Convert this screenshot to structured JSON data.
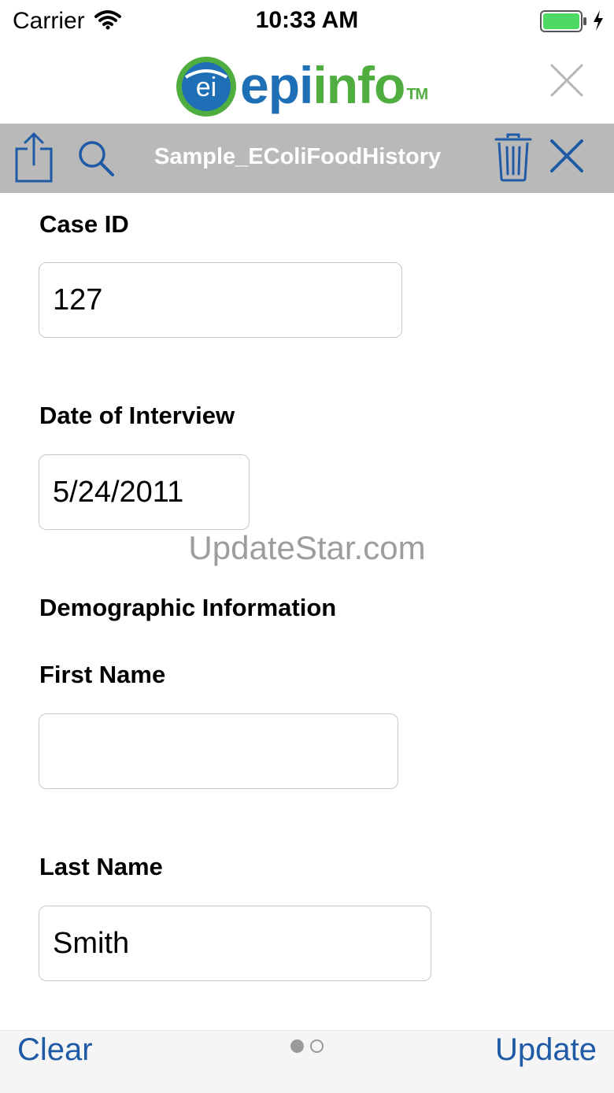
{
  "status_bar": {
    "carrier": "Carrier",
    "time": "10:33 AM"
  },
  "logo": {
    "mark_text": "ei",
    "part1": "epi",
    "part2": "info",
    "trademark": "TM"
  },
  "toolbar": {
    "title": "Sample_EColiFoodHistory"
  },
  "form": {
    "case_id": {
      "label": "Case ID",
      "value": "127"
    },
    "date_of_interview": {
      "label": "Date of Interview",
      "value": "5/24/2011"
    },
    "section_heading": "Demographic Information",
    "first_name": {
      "label": "First Name",
      "value": ""
    },
    "last_name": {
      "label": "Last Name",
      "value": "Smith"
    }
  },
  "watermark": "UpdateStar.com",
  "bottom_bar": {
    "clear_label": "Clear",
    "update_label": "Update",
    "page_count": 2,
    "current_page": 1
  },
  "colors": {
    "accent": "#1e5aa6",
    "toolbar_bg": "#b9b9b9",
    "logo_blue": "#1e6fb5",
    "logo_green": "#4fae3f",
    "battery": "#4cd964"
  },
  "icons": [
    "wifi-icon",
    "battery-icon",
    "charging-icon",
    "close-icon",
    "share-icon",
    "search-icon",
    "trash-icon"
  ]
}
